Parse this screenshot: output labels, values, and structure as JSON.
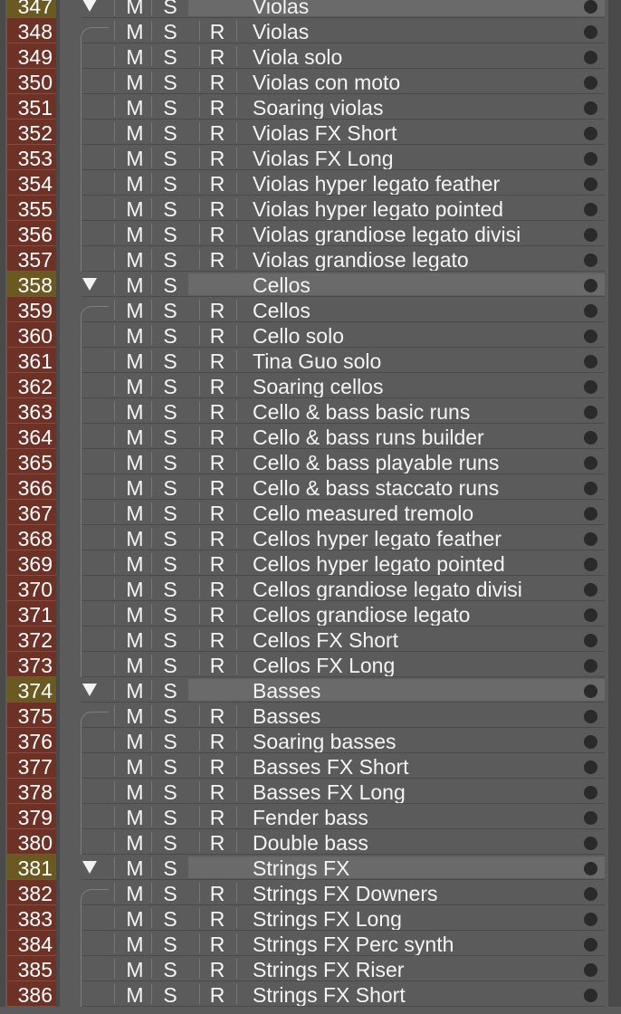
{
  "labels": {
    "mute": "M",
    "solo": "S",
    "record": "R"
  },
  "colors": {
    "number_bg": "#6d3126",
    "folder_number_bg": "#6a5a22",
    "track_bg": "#5b5b5b"
  },
  "rows": [
    {
      "num": "347",
      "name": "Violas",
      "folder": true
    },
    {
      "num": "348",
      "name": "Violas",
      "folder": false
    },
    {
      "num": "349",
      "name": "Viola solo",
      "folder": false
    },
    {
      "num": "350",
      "name": "Violas con moto",
      "folder": false
    },
    {
      "num": "351",
      "name": "Soaring violas",
      "folder": false
    },
    {
      "num": "352",
      "name": "Violas FX Short",
      "folder": false
    },
    {
      "num": "353",
      "name": "Violas FX Long",
      "folder": false
    },
    {
      "num": "354",
      "name": "Violas hyper legato feather",
      "folder": false
    },
    {
      "num": "355",
      "name": "Violas hyper legato pointed",
      "folder": false
    },
    {
      "num": "356",
      "name": "Violas grandiose legato divisi",
      "folder": false
    },
    {
      "num": "357",
      "name": "Violas grandiose legato",
      "folder": false
    },
    {
      "num": "358",
      "name": "Cellos",
      "folder": true
    },
    {
      "num": "359",
      "name": "Cellos",
      "folder": false
    },
    {
      "num": "360",
      "name": "Cello solo",
      "folder": false
    },
    {
      "num": "361",
      "name": "Tina Guo solo",
      "folder": false
    },
    {
      "num": "362",
      "name": "Soaring cellos",
      "folder": false
    },
    {
      "num": "363",
      "name": "Cello & bass basic runs",
      "folder": false
    },
    {
      "num": "364",
      "name": "Cello & bass runs builder",
      "folder": false
    },
    {
      "num": "365",
      "name": "Cello & bass playable runs",
      "folder": false
    },
    {
      "num": "366",
      "name": "Cello & bass staccato runs",
      "folder": false
    },
    {
      "num": "367",
      "name": "Cello measured tremolo",
      "folder": false
    },
    {
      "num": "368",
      "name": "Cellos hyper legato feather",
      "folder": false
    },
    {
      "num": "369",
      "name": "Cellos hyper legato pointed",
      "folder": false
    },
    {
      "num": "370",
      "name": "Cellos grandiose legato divisi",
      "folder": false
    },
    {
      "num": "371",
      "name": "Cellos grandiose legato",
      "folder": false
    },
    {
      "num": "372",
      "name": "Cellos FX Short",
      "folder": false
    },
    {
      "num": "373",
      "name": "Cellos FX Long",
      "folder": false
    },
    {
      "num": "374",
      "name": "Basses",
      "folder": true
    },
    {
      "num": "375",
      "name": "Basses",
      "folder": false
    },
    {
      "num": "376",
      "name": "Soaring basses",
      "folder": false
    },
    {
      "num": "377",
      "name": "Basses FX Short",
      "folder": false
    },
    {
      "num": "378",
      "name": "Basses FX Long",
      "folder": false
    },
    {
      "num": "379",
      "name": "Fender bass",
      "folder": false
    },
    {
      "num": "380",
      "name": "Double bass",
      "folder": false
    },
    {
      "num": "381",
      "name": "Strings FX",
      "folder": true
    },
    {
      "num": "382",
      "name": "Strings FX Downers",
      "folder": false
    },
    {
      "num": "383",
      "name": "Strings FX Long",
      "folder": false
    },
    {
      "num": "384",
      "name": "Strings FX Perc synth",
      "folder": false
    },
    {
      "num": "385",
      "name": "Strings FX Riser",
      "folder": false
    },
    {
      "num": "386",
      "name": "Strings FX Short",
      "folder": false
    }
  ]
}
